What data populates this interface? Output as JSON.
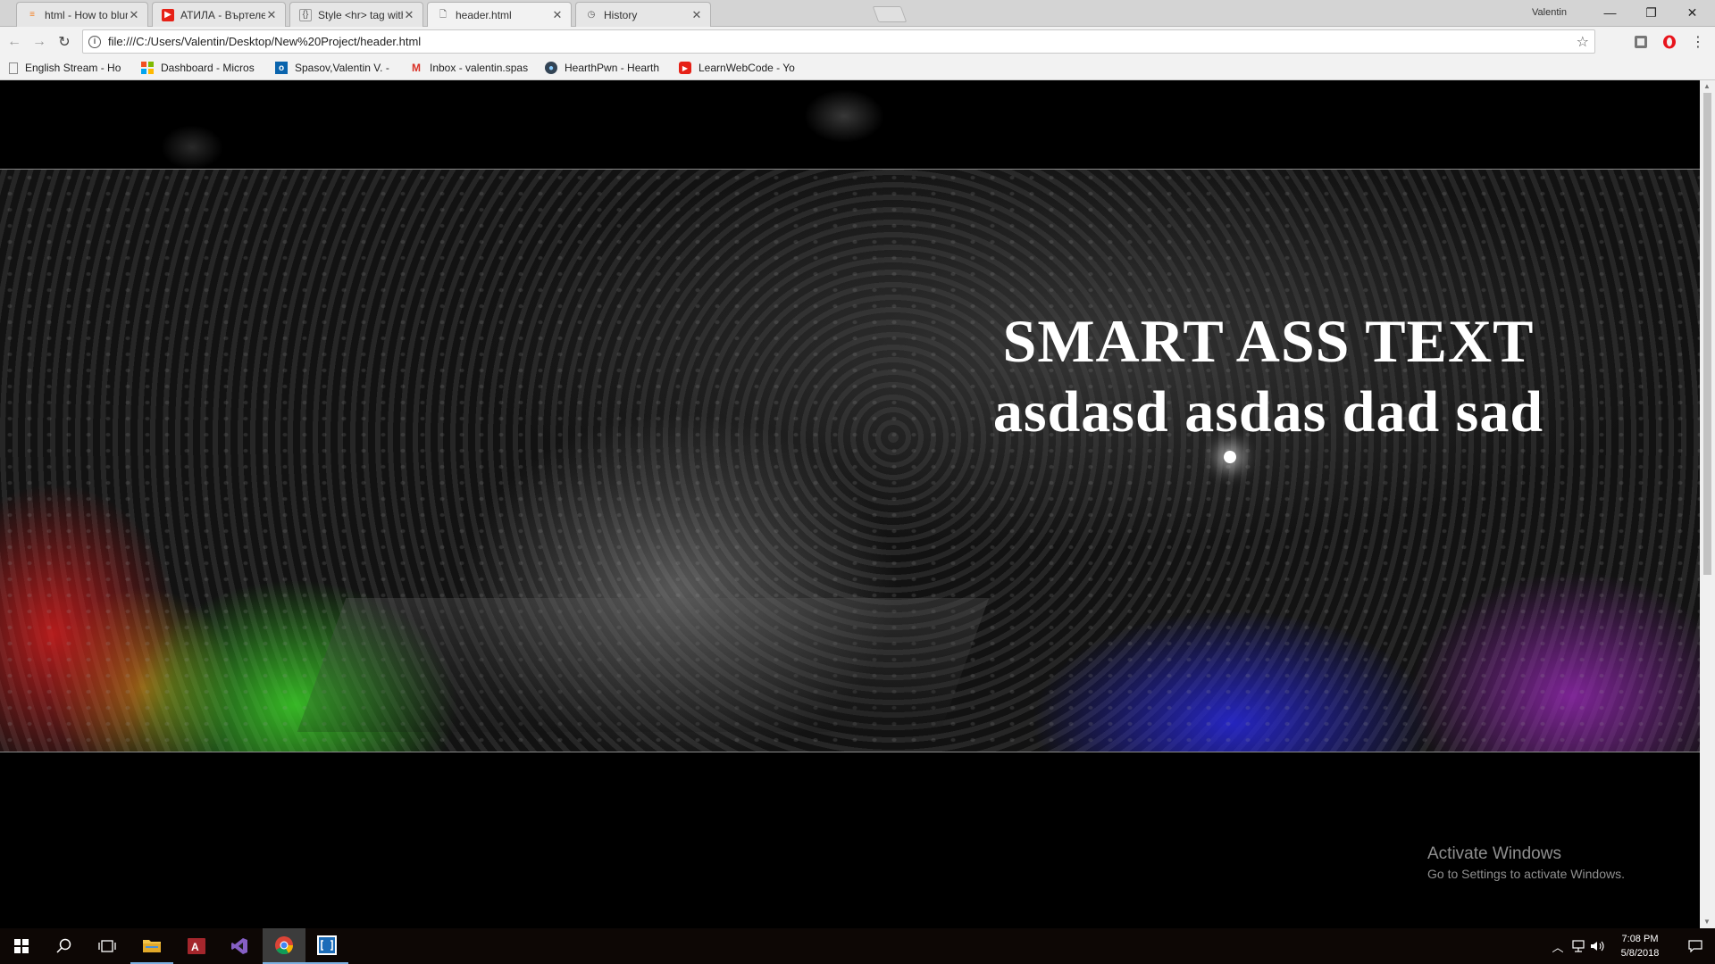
{
  "tabs": [
    {
      "title": "html - How to blur(css) d",
      "icon": "stackoverflow-icon",
      "active": false
    },
    {
      "title": "АТИЛА - Въртележка pr",
      "icon": "youtube-icon",
      "active": false
    },
    {
      "title": "Style <hr> tag with CSS",
      "icon": "css-icon",
      "active": false
    },
    {
      "title": "header.html",
      "icon": "file-icon",
      "active": true
    },
    {
      "title": "History",
      "icon": "history-icon",
      "active": false
    }
  ],
  "profile_name": "Valentin",
  "address": "file:///C:/Users/Valentin/Desktop/New%20Project/header.html",
  "bookmarks": [
    {
      "label": "English Stream - Ho",
      "icon": "page-icon"
    },
    {
      "label": "Dashboard - Micros",
      "icon": "microsoft-icon"
    },
    {
      "label": "Spasov,Valentin V. -",
      "icon": "outlook-icon"
    },
    {
      "label": "Inbox - valentin.spas",
      "icon": "gmail-icon"
    },
    {
      "label": "HearthPwn - Hearth",
      "icon": "hearthpwn-icon"
    },
    {
      "label": "LearnWebCode - Yo",
      "icon": "youtube-icon"
    }
  ],
  "page": {
    "headline_line1": "SMART ASS TEXT",
    "headline_line2": "asdasd asdas dad sad"
  },
  "watermark": {
    "title": "Activate Windows",
    "subtitle": "Go to Settings to activate Windows."
  },
  "clock": {
    "time": "7:08 PM",
    "date": "5/8/2018"
  },
  "colors": {
    "youtube": "#e62117",
    "opera": "#e8141c",
    "taskbar_accent": "#7ab0e0"
  }
}
